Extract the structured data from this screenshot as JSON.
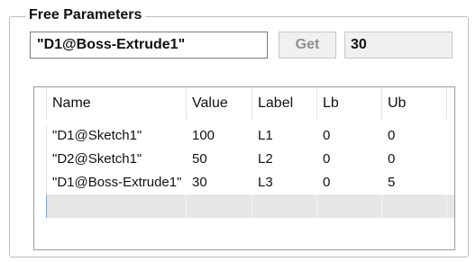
{
  "group": {
    "title": "Free Parameters"
  },
  "parameter": {
    "input_value": "\"D1@Boss-Extrude1\"",
    "get_label": "Get",
    "current_value": "30"
  },
  "table": {
    "columns": [
      "Name",
      "Value",
      "Label",
      "Lb",
      "Ub"
    ],
    "rows": [
      {
        "name": "\"D1@Sketch1\"",
        "value": "100",
        "label": "L1",
        "lb": "0",
        "ub": "0"
      },
      {
        "name": "\"D2@Sketch1\"",
        "value": "50",
        "label": "L2",
        "lb": "0",
        "ub": "0"
      },
      {
        "name": "\"D1@Boss-Extrude1\"",
        "value": "30",
        "label": "L3",
        "lb": "0",
        "ub": "5"
      }
    ]
  }
}
